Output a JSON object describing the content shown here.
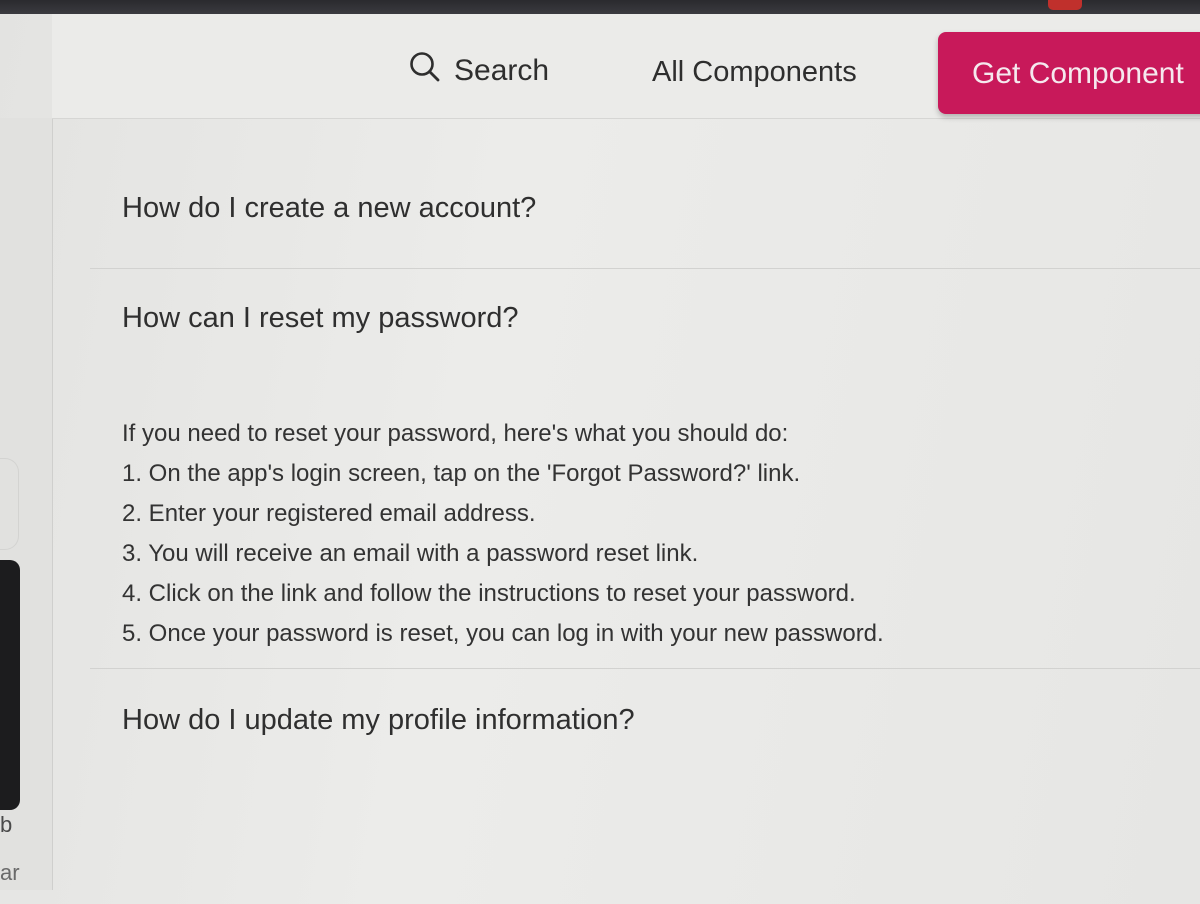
{
  "header": {
    "search_label": "Search",
    "all_components_label": "All Components",
    "get_button_label": "Get Component"
  },
  "faq": {
    "items": [
      {
        "question": "How do I create a new account?"
      },
      {
        "question": "How can I reset my password?",
        "answer_intro": "If you need to reset your password, here's what you should do:",
        "steps": [
          "1. On the app's login screen, tap on the 'Forgot Password?' link.",
          "2. Enter your registered email address.",
          "3. You will receive an email with a password reset link.",
          "4. Click on the link and follow the instructions to reset your password.",
          "5. Once your password is reset, you can log in with your new password."
        ]
      },
      {
        "question": "How do I update my profile information?"
      }
    ]
  },
  "sidebar": {
    "fragment_1": "b",
    "fragment_2": "ar"
  },
  "colors": {
    "accent": "#c8195a",
    "text": "#2f2f2f",
    "background": "#ebebe9"
  },
  "icons": {
    "search": "search-icon"
  }
}
